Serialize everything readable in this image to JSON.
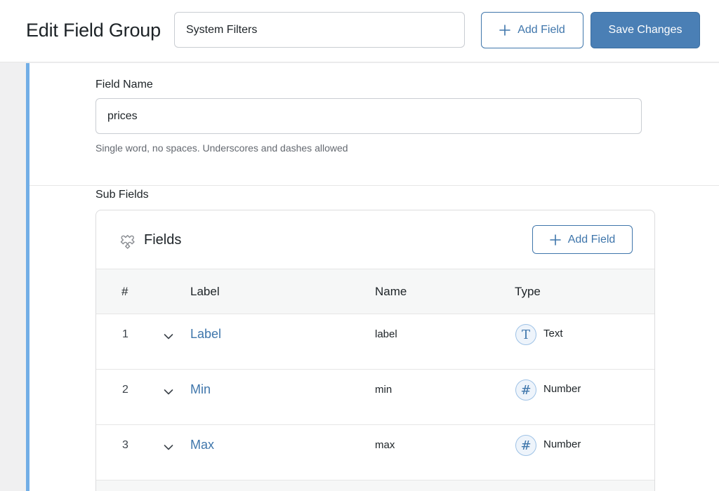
{
  "header": {
    "title": "Edit Field Group",
    "group_name_value": "System Filters",
    "add_field_label": "Add Field",
    "save_label": "Save Changes"
  },
  "field": {
    "name_label": "Field Name",
    "name_value": "prices",
    "help_text": "Single word, no spaces. Underscores and dashes allowed"
  },
  "sub_fields": {
    "section_label": "Sub Fields",
    "panel_title": "Fields",
    "add_field_label": "Add Field",
    "columns": [
      "#",
      "Label",
      "Name",
      "Type"
    ],
    "rows": [
      {
        "index": "1",
        "label": "Label",
        "name": "label",
        "type": "Text",
        "type_icon": "text-icon",
        "type_glyph": "T"
      },
      {
        "index": "2",
        "label": "Min",
        "name": "min",
        "type": "Number",
        "type_icon": "number-icon",
        "type_glyph": "#"
      },
      {
        "index": "3",
        "label": "Max",
        "name": "max",
        "type": "Number",
        "type_icon": "number-icon",
        "type_glyph": "#"
      }
    ]
  },
  "colors": {
    "accent": "#3f76ab",
    "primary_button": "#4a7fb5",
    "left_accent_bar": "#72aee6"
  }
}
